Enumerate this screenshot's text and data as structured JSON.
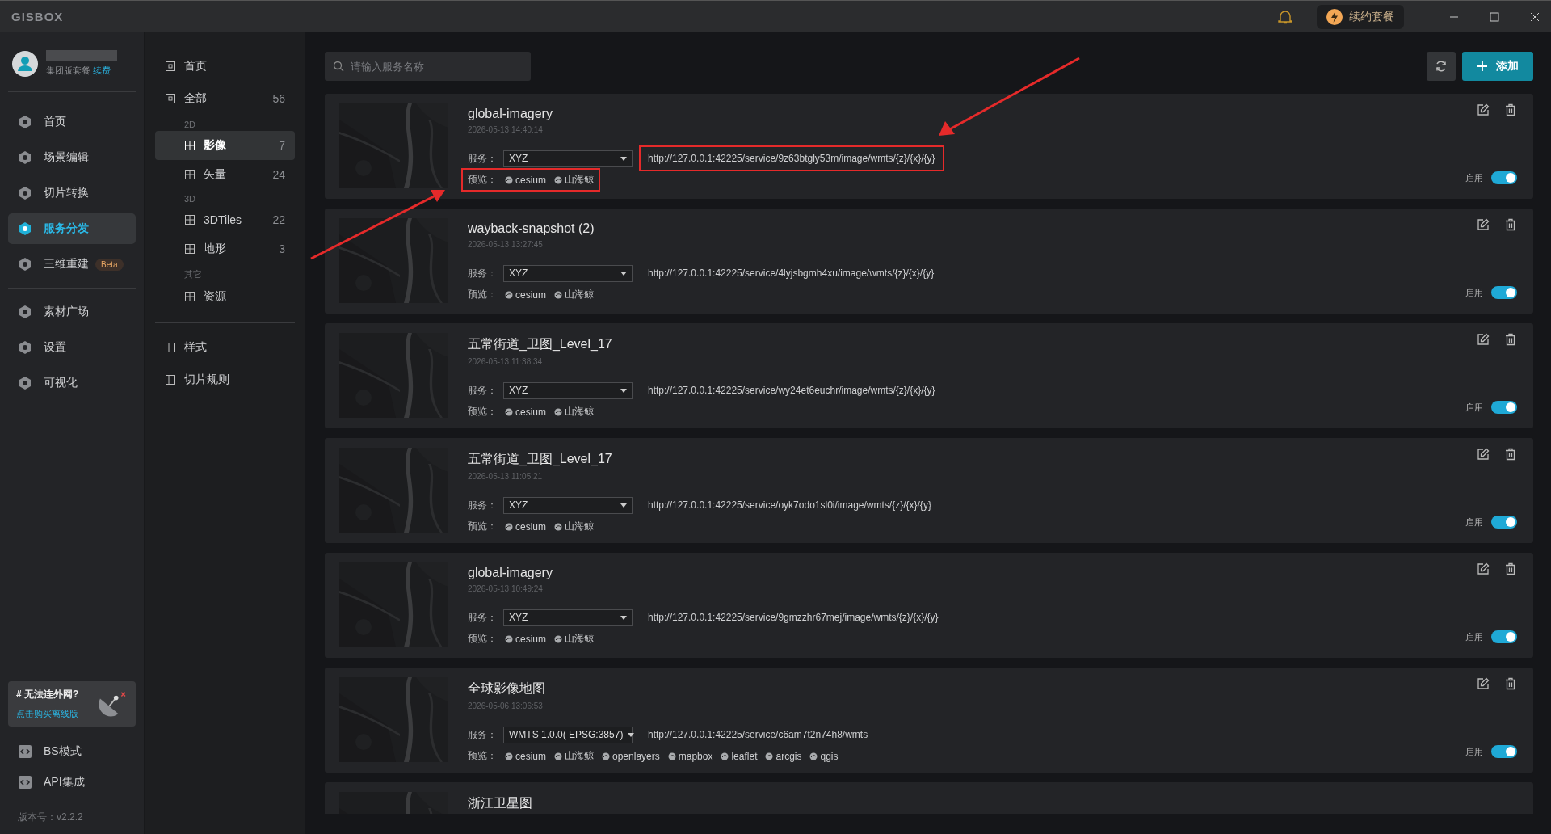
{
  "titlebar": {
    "logo": "GISBOX",
    "renew_label": "续约套餐"
  },
  "user": {
    "plan": "集团版套餐",
    "renew_link": "续费"
  },
  "main_nav": [
    {
      "label": "首页",
      "selected": false
    },
    {
      "label": "场景编辑",
      "selected": false
    },
    {
      "label": "切片转换",
      "selected": false
    },
    {
      "label": "服务分发",
      "selected": true
    },
    {
      "label": "三维重建",
      "selected": false,
      "badge": "Beta"
    },
    {
      "label": "素材广场",
      "selected": false
    },
    {
      "label": "设置",
      "selected": false
    },
    {
      "label": "可视化",
      "selected": false
    }
  ],
  "promo": {
    "title": "# 无法连外网?",
    "link": "点击购买离线版"
  },
  "bottom_nav": [
    {
      "label": "BS模式"
    },
    {
      "label": "API集成"
    }
  ],
  "version": "版本号：v2.2.2",
  "category_nav": {
    "top": [
      {
        "label": "首页",
        "selected": false
      },
      {
        "label": "全部",
        "count": "56",
        "selected": false
      }
    ],
    "groups": [
      {
        "heading": "2D",
        "items": [
          {
            "label": "影像",
            "count": "7",
            "selected": true
          },
          {
            "label": "矢量",
            "count": "24",
            "selected": false
          }
        ]
      },
      {
        "heading": "3D",
        "items": [
          {
            "label": "3DTiles",
            "count": "22",
            "selected": false
          },
          {
            "label": "地形",
            "count": "3",
            "selected": false
          }
        ]
      },
      {
        "heading": "其它",
        "items": [
          {
            "label": "资源",
            "selected": false
          }
        ]
      }
    ],
    "bottom": [
      {
        "label": "样式",
        "selected": false
      },
      {
        "label": "切片规则",
        "selected": false
      }
    ]
  },
  "search": {
    "placeholder": "请输入服务名称"
  },
  "add_button": "添加",
  "services": [
    {
      "name": "global-imagery",
      "time": "2026-05-13 14:40:14",
      "service_label": "服务：",
      "service": "XYZ",
      "url": "http://127.0.0.1:42225/service/9z63btgly53m/image/wmts/{z}/{x}/{y}",
      "preview_label": "预览：",
      "previews": [
        "cesium",
        "山海鲸"
      ],
      "enable_label": "启用",
      "enabled": true,
      "url_marked": true,
      "preview_marked": true
    },
    {
      "name": "wayback-snapshot (2)",
      "time": "2026-05-13 13:27:45",
      "service_label": "服务：",
      "service": "XYZ",
      "url": "http://127.0.0.1:42225/service/4lyjsbgmh4xu/image/wmts/{z}/{x}/{y}",
      "preview_label": "预览：",
      "previews": [
        "cesium",
        "山海鲸"
      ],
      "enable_label": "启用",
      "enabled": true,
      "url_marked": false,
      "preview_marked": false
    },
    {
      "name": "五常街道_卫图_Level_17",
      "time": "2026-05-13 11:38:34",
      "service_label": "服务：",
      "service": "XYZ",
      "url": "http://127.0.0.1:42225/service/wy24et6euchr/image/wmts/{z}/{x}/{y}",
      "preview_label": "预览：",
      "previews": [
        "cesium",
        "山海鲸"
      ],
      "enable_label": "启用",
      "enabled": true,
      "url_marked": false,
      "preview_marked": false
    },
    {
      "name": "五常街道_卫图_Level_17",
      "time": "2026-05-13 11:05:21",
      "service_label": "服务：",
      "service": "XYZ",
      "url": "http://127.0.0.1:42225/service/oyk7odo1sl0i/image/wmts/{z}/{x}/{y}",
      "preview_label": "预览：",
      "previews": [
        "cesium",
        "山海鲸"
      ],
      "enable_label": "启用",
      "enabled": true,
      "url_marked": false,
      "preview_marked": false
    },
    {
      "name": "global-imagery",
      "time": "2026-05-13 10:49:24",
      "service_label": "服务：",
      "service": "XYZ",
      "url": "http://127.0.0.1:42225/service/9gmzzhr67mej/image/wmts/{z}/{x}/{y}",
      "preview_label": "预览：",
      "previews": [
        "cesium",
        "山海鲸"
      ],
      "enable_label": "启用",
      "enabled": true,
      "url_marked": false,
      "preview_marked": false
    },
    {
      "name": "全球影像地图",
      "time": "2026-05-06 13:06:53",
      "service_label": "服务：",
      "service": "WMTS 1.0.0( EPSG:3857)",
      "url": "http://127.0.0.1:42225/service/c6am7t2n74h8/wmts",
      "preview_label": "预览：",
      "previews": [
        "cesium",
        "山海鲸",
        "openlayers",
        "mapbox",
        "leaflet",
        "arcgis",
        "qgis"
      ],
      "enable_label": "启用",
      "enabled": true,
      "url_marked": false,
      "preview_marked": false
    },
    {
      "name": "浙江卫星图"
    }
  ]
}
